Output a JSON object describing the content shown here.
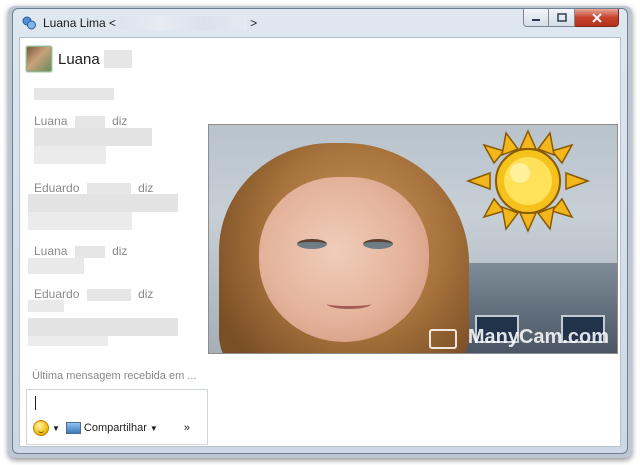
{
  "window": {
    "title_prefix": "Luana Lima <",
    "title_suffix": ">"
  },
  "contact": {
    "name": "Luana"
  },
  "messages": [
    {
      "sender": "Luana",
      "verb": "diz"
    },
    {
      "sender": "Eduardo",
      "verb": "diz"
    },
    {
      "sender": "Luana",
      "verb": "diz"
    },
    {
      "sender": "Eduardo",
      "verb": "diz"
    }
  ],
  "status": {
    "last_message": "Última mensagem recebida em ..."
  },
  "toolbar": {
    "share_label": "Compartilhar",
    "more_label": "»"
  },
  "video": {
    "watermark": "ManyCam.com"
  },
  "icons": {
    "app": "messenger-icon",
    "emoticon": "emoticon-icon",
    "share": "share-icon",
    "minimize": "minimize-icon",
    "maximize": "maximize-icon",
    "close": "close-icon"
  },
  "colors": {
    "close_button": "#c7412b",
    "sender_text": "#8a8a8a"
  }
}
